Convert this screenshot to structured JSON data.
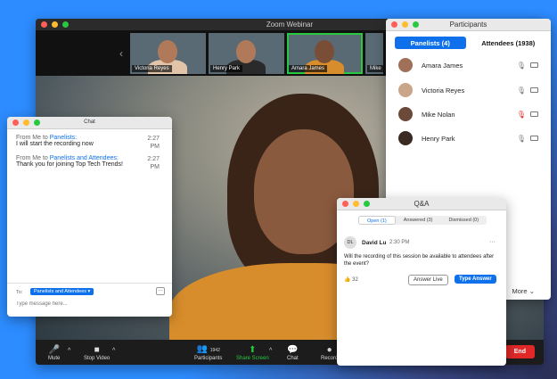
{
  "main": {
    "title": "Zoom Webinar",
    "thumbnails": [
      {
        "name": "Victoria Reyes",
        "active": false
      },
      {
        "name": "Henry Park",
        "active": false
      },
      {
        "name": "Amara James",
        "active": true
      },
      {
        "name": "Mike",
        "active": false
      }
    ],
    "toolbar": {
      "mute": "Mute",
      "stop_video": "Stop Video",
      "participants": "Participants",
      "participants_count": "1942",
      "share_screen": "Share Screen",
      "chat": "Chat",
      "record": "Record",
      "end": "End"
    }
  },
  "participants": {
    "title": "Participants",
    "tab_panelists": "Panelists (4)",
    "tab_attendees": "Attendees (1938)",
    "list": [
      {
        "name": "Amara James",
        "muted": false
      },
      {
        "name": "Victoria Reyes",
        "muted": false
      },
      {
        "name": "Mike Nolan",
        "muted": true
      },
      {
        "name": "Henry Park",
        "muted": false
      }
    ],
    "more": "More"
  },
  "chat": {
    "title": "Chat",
    "messages": [
      {
        "from": "From Me to",
        "to": "Panelists:",
        "time": "2:27 PM",
        "text": "I will start the recording now"
      },
      {
        "from": "From Me to",
        "to": "Panelists and Attendees:",
        "time": "2:27 PM",
        "text": "Thank you for joining Top Tech Trends!"
      }
    ],
    "to_label": "To:",
    "to_value": "Panelists and Attendees",
    "input_placeholder": "Type message here..."
  },
  "qa": {
    "title": "Q&A",
    "tabs": [
      "Open (1)",
      "Answered (3)",
      "Dismissed (0)"
    ],
    "question": {
      "initials": "DL",
      "name": "David Lu",
      "time": "2:30 PM",
      "text": "Will the recording of this session be available to attendees after the event?",
      "likes": "32"
    },
    "answer_live": "Answer Live",
    "type_answer": "Type Answer"
  },
  "colors": {
    "accent": "#0e71eb",
    "end": "#e02828",
    "background": "#2d8cff",
    "active_border": "#28c840"
  }
}
